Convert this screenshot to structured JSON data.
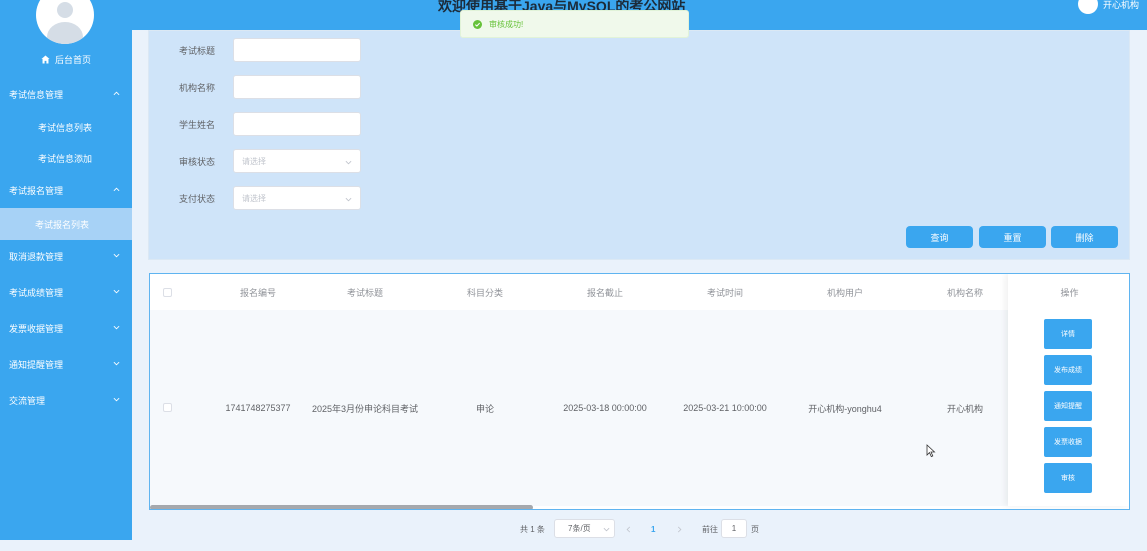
{
  "header": {
    "site_title": "欢迎使用基于Java与MySQL的考公网站",
    "user_name": "开心机构"
  },
  "toast": {
    "message": "审核成功!",
    "type": "success",
    "color": "#67c23a"
  },
  "sidebar": {
    "home_label": "后台首页",
    "groups": [
      {
        "label": "考试信息管理",
        "expanded": true,
        "children": [
          "考试信息列表",
          "考试信息添加"
        ]
      },
      {
        "label": "考试报名管理",
        "expanded": true,
        "children": [
          "考试报名列表"
        ],
        "active_child": "考试报名列表"
      },
      {
        "label": "取消退款管理",
        "expanded": false
      },
      {
        "label": "考试成绩管理",
        "expanded": false
      },
      {
        "label": "发票收据管理",
        "expanded": false
      },
      {
        "label": "通知提醒管理",
        "expanded": false
      },
      {
        "label": "交流管理",
        "expanded": false
      }
    ]
  },
  "search_form": {
    "fields": [
      {
        "label": "考试标题",
        "value": "",
        "type": "text"
      },
      {
        "label": "机构名称",
        "value": "",
        "type": "text"
      },
      {
        "label": "学生姓名",
        "value": "",
        "type": "text"
      },
      {
        "label": "审核状态",
        "placeholder": "请选择",
        "type": "select"
      },
      {
        "label": "支付状态",
        "placeholder": "请选择",
        "type": "select"
      }
    ],
    "buttons": {
      "query": "查询",
      "reset": "重置",
      "delete": "删除"
    }
  },
  "table": {
    "columns": [
      "报名编号",
      "考试标题",
      "科目分类",
      "报名截止",
      "考试时间",
      "机构用户",
      "机构名称",
      "操作"
    ],
    "rows": [
      {
        "id": "1741748275377",
        "title": "2025年3月份申论科目考试",
        "category": "申论",
        "deadline": "2025-03-18 00:00:00",
        "exam_time": "2025-03-21 10:00:00",
        "org_user": "开心机构-yonghu4",
        "org_name": "开心机构",
        "actions": [
          "详情",
          "发布成绩",
          "通知提醒",
          "发票收据",
          "审核"
        ]
      }
    ]
  },
  "pagination": {
    "total_text": "共 1 条",
    "page_size": "7条/页",
    "current_page": "1",
    "goto_label": "前往",
    "goto_value": "1",
    "page_suffix": "页"
  },
  "colors": {
    "primary": "#3aa6ef",
    "active_menu": "#a7d2f6",
    "panel": "#cfe4f9"
  }
}
